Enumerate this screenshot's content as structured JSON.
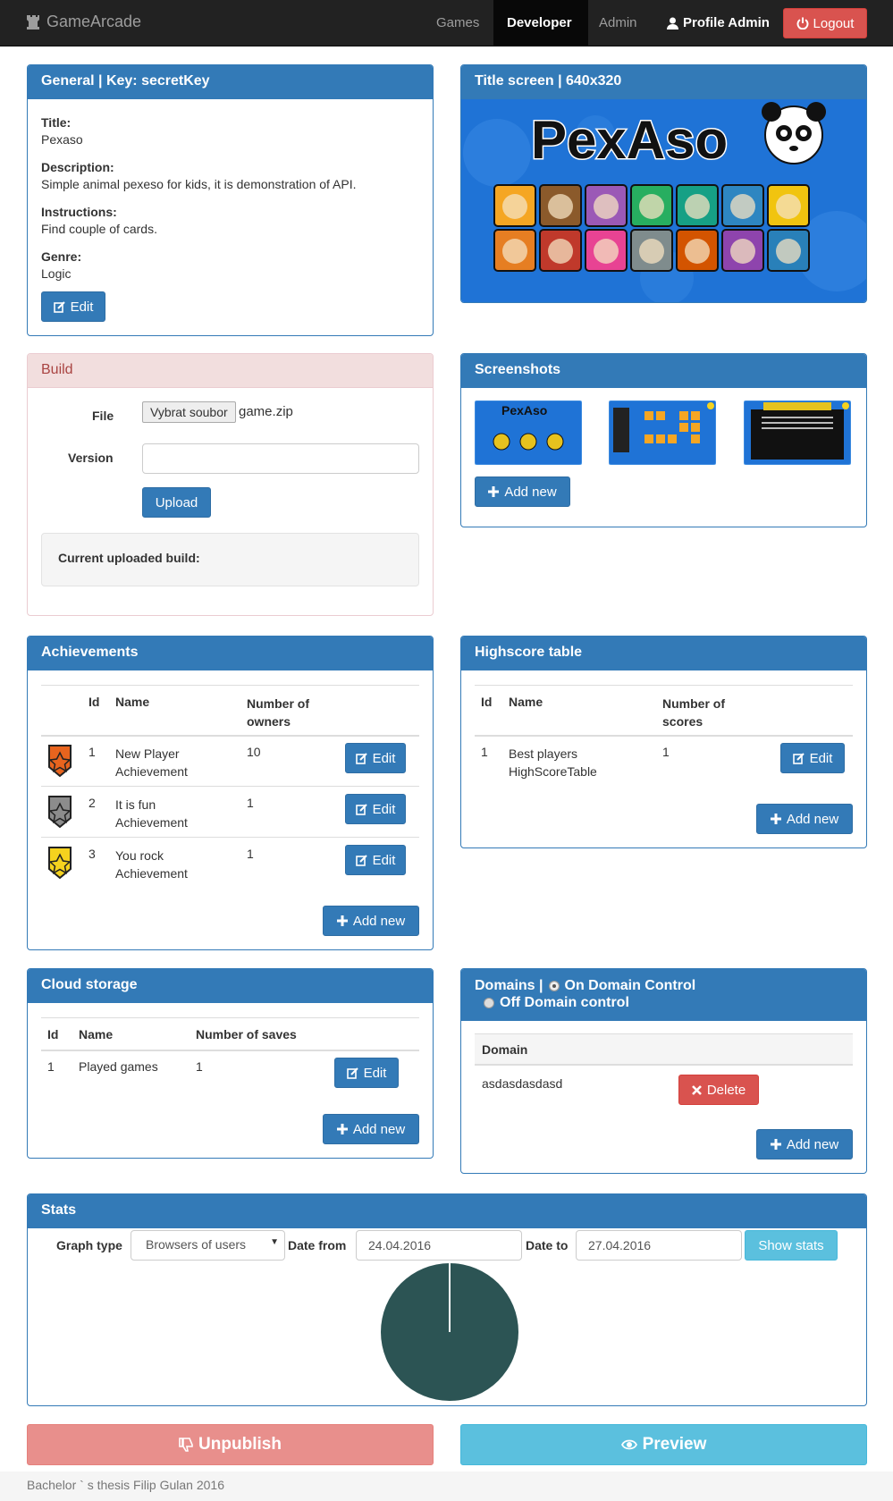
{
  "navbar": {
    "brand": "GameArcade",
    "items": [
      "Games",
      "Developer",
      "Admin"
    ],
    "profile": "Profile Admin",
    "logout": "Logout"
  },
  "general": {
    "heading": "General | Key: secretKey",
    "title_label": "Title:",
    "title": "Pexaso",
    "description_label": "Description:",
    "description": "Simple animal pexeso for kids, it is demonstration of API.",
    "instructions_label": "Instructions:",
    "instructions": "Find couple of cards.",
    "genre_label": "Genre:",
    "genre": "Logic",
    "edit": "Edit"
  },
  "title_screen": {
    "heading": "Title screen | 640x320",
    "logo_text": "PexAso"
  },
  "build": {
    "heading": "Build",
    "file_label": "File",
    "file_button": "Vybrat soubor",
    "file_name": "game.zip",
    "version_label": "Version",
    "version_value": "",
    "upload": "Upload",
    "current": "Current uploaded build:"
  },
  "screenshots": {
    "heading": "Screenshots",
    "add_new": "Add new"
  },
  "achievements": {
    "heading": "Achievements",
    "columns": [
      "Id",
      "Name",
      "Number of owners"
    ],
    "rows": [
      {
        "id": "1",
        "name": "New Player Achievement",
        "owners": "10",
        "color": "#e8641e"
      },
      {
        "id": "2",
        "name": "It is fun Achievement",
        "owners": "1",
        "color": "#8c8c8c"
      },
      {
        "id": "3",
        "name": "You rock Achievement",
        "owners": "1",
        "color": "#f5d21e"
      }
    ],
    "edit": "Edit",
    "add_new": "Add new"
  },
  "highscore": {
    "heading": "Highscore table",
    "columns": [
      "Id",
      "Name",
      "Number of scores"
    ],
    "rows": [
      {
        "id": "1",
        "name": "Best players HighScoreTable",
        "scores": "1"
      }
    ],
    "edit": "Edit",
    "add_new": "Add new"
  },
  "cloud": {
    "heading": "Cloud storage",
    "columns": [
      "Id",
      "Name",
      "Number of saves"
    ],
    "rows": [
      {
        "id": "1",
        "name": "Played games",
        "saves": "1"
      }
    ],
    "edit": "Edit",
    "add_new": "Add new"
  },
  "domains": {
    "heading": "Domains |",
    "option_on": "On Domain Control",
    "option_off": "Off Domain control",
    "column": "Domain",
    "rows": [
      {
        "domain": "asdasdasdasd"
      }
    ],
    "delete": "Delete",
    "add_new": "Add new"
  },
  "stats": {
    "heading": "Stats",
    "graph_type_label": "Graph type",
    "graph_type_value": "Browsers of users",
    "date_from_label": "Date from",
    "date_from": "24.04.2016",
    "date_to_label": "Date to",
    "date_to": "27.04.2016",
    "show": "Show stats",
    "pie_color": "#2c5454"
  },
  "actions": {
    "unpublish": "Unpublish",
    "preview": "Preview"
  },
  "footer": "Bachelor ` s thesis Filip Gulan 2016"
}
